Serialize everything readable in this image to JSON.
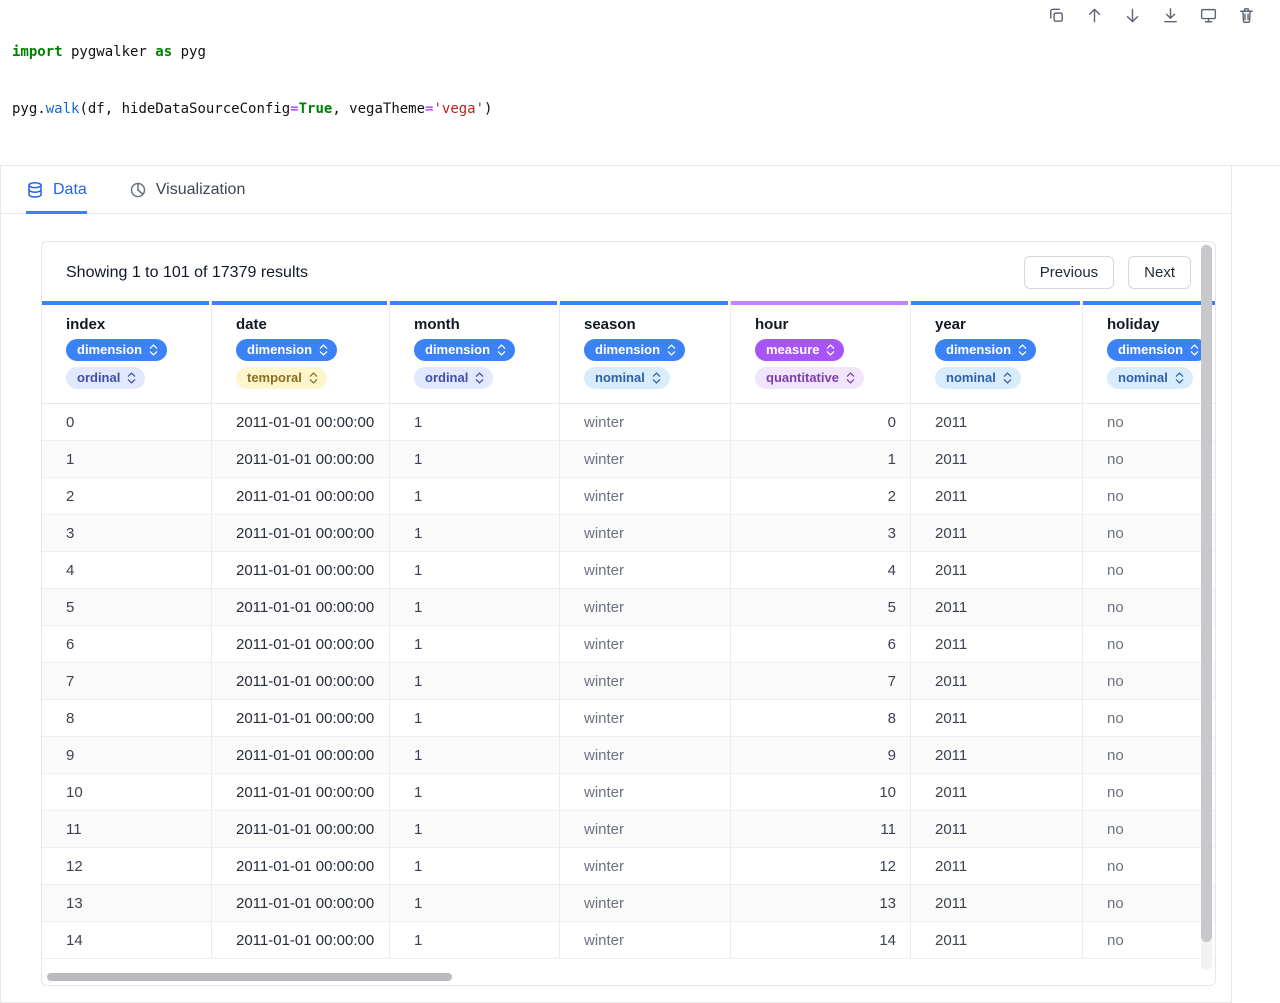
{
  "colors": {
    "tab-active": "#2563eb",
    "tab-underline": "#3b82f6",
    "code-keyword": "#008000",
    "code-function": "#1366d6",
    "code-string": "#ba2121",
    "code-operator": "#aa22ff"
  },
  "code": {
    "line1": {
      "kw_import": "import",
      "id1": " pygwalker ",
      "kw_as": "as",
      "id2": " pyg"
    },
    "line2": {
      "id1": "pyg.",
      "fn": "walk",
      "id2": "(df, hideDataSourceConfig",
      "op1": "=",
      "kw_true": "True",
      "id3": ", vegaTheme",
      "op2": "=",
      "str": "'vega'",
      "id4": ")"
    }
  },
  "toolbar": {
    "icons": [
      "copy",
      "move-up",
      "move-down",
      "download",
      "presentation",
      "delete"
    ]
  },
  "tabs": [
    {
      "label": "Data",
      "icon": "database"
    },
    {
      "label": "Visualization",
      "icon": "pie-chart"
    }
  ],
  "pagination": {
    "previous": "Previous",
    "next": "Next"
  },
  "table": {
    "summary": "Showing 1 to 101 of 17379 results",
    "kind_styles": {
      "dimension": {
        "pill": "#3b82f6",
        "accent": "#3b82f6"
      },
      "measure": {
        "pill": "#a855f7",
        "accent": "#c084fc"
      }
    },
    "type_styles": {
      "ordinal": {
        "bg": "#e2e8fd",
        "fg": "#3f4ea8"
      },
      "temporal": {
        "bg": "#fdf6cd",
        "fg": "#8a6d1d"
      },
      "nominal": {
        "bg": "#d9ecfb",
        "fg": "#2d5fa8"
      },
      "quantitative": {
        "bg": "#f1e5fb",
        "fg": "#7d3fa8"
      }
    },
    "columns": [
      {
        "name": "index",
        "kind": "dimension",
        "type": "ordinal"
      },
      {
        "name": "date",
        "kind": "dimension",
        "type": "temporal"
      },
      {
        "name": "month",
        "kind": "dimension",
        "type": "ordinal"
      },
      {
        "name": "season",
        "kind": "dimension",
        "type": "nominal"
      },
      {
        "name": "hour",
        "kind": "measure",
        "type": "quantitative"
      },
      {
        "name": "year",
        "kind": "dimension",
        "type": "nominal"
      },
      {
        "name": "holiday",
        "kind": "dimension",
        "type": "nominal"
      }
    ],
    "rows": [
      [
        "0",
        "2011-01-01 00:00:00",
        "1",
        "winter",
        "0",
        "2011",
        "no"
      ],
      [
        "1",
        "2011-01-01 00:00:00",
        "1",
        "winter",
        "1",
        "2011",
        "no"
      ],
      [
        "2",
        "2011-01-01 00:00:00",
        "1",
        "winter",
        "2",
        "2011",
        "no"
      ],
      [
        "3",
        "2011-01-01 00:00:00",
        "1",
        "winter",
        "3",
        "2011",
        "no"
      ],
      [
        "4",
        "2011-01-01 00:00:00",
        "1",
        "winter",
        "4",
        "2011",
        "no"
      ],
      [
        "5",
        "2011-01-01 00:00:00",
        "1",
        "winter",
        "5",
        "2011",
        "no"
      ],
      [
        "6",
        "2011-01-01 00:00:00",
        "1",
        "winter",
        "6",
        "2011",
        "no"
      ],
      [
        "7",
        "2011-01-01 00:00:00",
        "1",
        "winter",
        "7",
        "2011",
        "no"
      ],
      [
        "8",
        "2011-01-01 00:00:00",
        "1",
        "winter",
        "8",
        "2011",
        "no"
      ],
      [
        "9",
        "2011-01-01 00:00:00",
        "1",
        "winter",
        "9",
        "2011",
        "no"
      ],
      [
        "10",
        "2011-01-01 00:00:00",
        "1",
        "winter",
        "10",
        "2011",
        "no"
      ],
      [
        "11",
        "2011-01-01 00:00:00",
        "1",
        "winter",
        "11",
        "2011",
        "no"
      ],
      [
        "12",
        "2011-01-01 00:00:00",
        "1",
        "winter",
        "12",
        "2011",
        "no"
      ],
      [
        "13",
        "2011-01-01 00:00:00",
        "1",
        "winter",
        "13",
        "2011",
        "no"
      ],
      [
        "14",
        "2011-01-01 00:00:00",
        "1",
        "winter",
        "14",
        "2011",
        "no"
      ]
    ]
  }
}
